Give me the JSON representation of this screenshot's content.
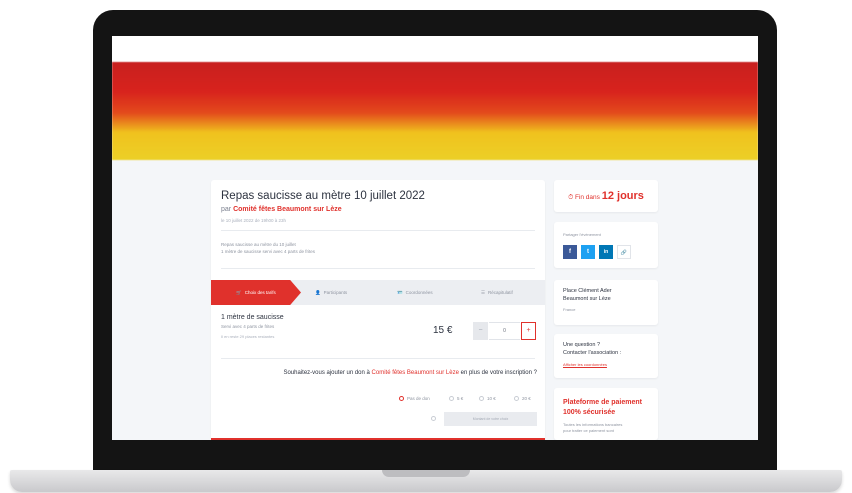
{
  "event": {
    "title": "Repas saucisse au mètre 10 juillet 2022",
    "by_prefix": "par",
    "organizer": "Comité fêtes Beaumont sur Lèze",
    "date_line": "le 10 juillet 2022 de 19h00 à 23h",
    "description_1": "Repas saucisse au mètre du 10 juillet",
    "description_2": "1 mètre de saucisse servi avec 4 parts de frites"
  },
  "tabs": [
    {
      "label": "Choix des tarifs",
      "icon": "cart-icon"
    },
    {
      "label": "Participants",
      "icon": "person-icon"
    },
    {
      "label": "Coordonnées",
      "icon": "user-card-icon"
    },
    {
      "label": "Récapitulatif",
      "icon": "list-icon"
    }
  ],
  "ticket": {
    "name": "1 mètre de saucisse",
    "subtitle": "Servi avec 4 parts de frites",
    "remaining": "Il en reste 29 places restantes",
    "price": "15 €",
    "quantity": "0",
    "minus": "−",
    "plus": "+"
  },
  "donation": {
    "question_prefix": "Souhaitez-vous ajouter un don à",
    "organizer": "Comité fêtes Beaumont sur Lèze",
    "question_suffix": "en plus de votre inscription ?",
    "options": [
      "Pas de don",
      "5 €",
      "10 €",
      "20 €"
    ],
    "selected": "Pas de don",
    "custom_placeholder": "Montant de votre choix"
  },
  "sidebar": {
    "countdown_prefix": "Fin dans",
    "countdown_value": "12 jours",
    "share_label": "Partager l'événement",
    "share_buttons": [
      "f",
      "t",
      "in",
      "🔗"
    ],
    "place_line1": "Place Clément Ader",
    "place_line2": "Beaumont sur Lèze",
    "place_country": "France",
    "question_line1": "Une question ?",
    "question_line2": "Contacter l'association :",
    "question_link": "Afficher les coordonnées",
    "payment_line1": "Plateforme de paiement",
    "payment_line2": "100% sécurisée",
    "payment_desc1": "Toutes les informations bancaires",
    "payment_desc2": "pour traiter ce paiement sont"
  },
  "colors": {
    "accent": "#e0312c",
    "facebook": "#3b5998",
    "twitter": "#1da1f2",
    "linkedin": "#0077b5"
  }
}
